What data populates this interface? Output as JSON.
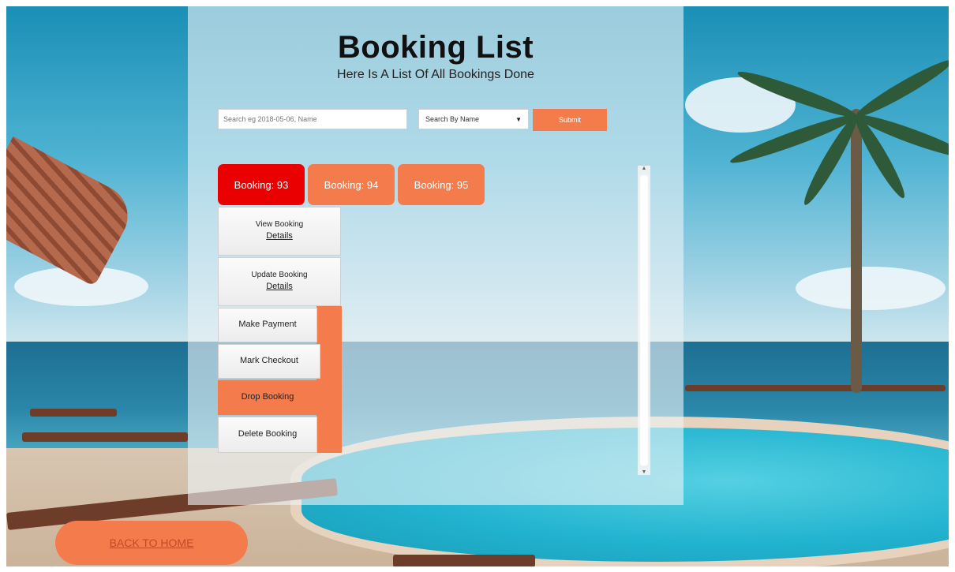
{
  "header": {
    "title": "Booking List",
    "subtitle": "Here Is A List Of All Bookings Done"
  },
  "search": {
    "placeholder": "Search eg 2018-05-06, Name",
    "filter_selected": "Search By Name",
    "submit_label": "Submit"
  },
  "tabs": [
    {
      "label": "Booking: 93",
      "active": true
    },
    {
      "label": "Booking: 94",
      "active": false
    },
    {
      "label": "Booking: 95",
      "active": false
    }
  ],
  "actions": {
    "view_line1": "View Booking",
    "view_line2": "Details",
    "update_line1": "Update Booking",
    "update_line2": "Details",
    "payment": "Make Payment",
    "checkout": "Mark Checkout",
    "drop": "Drop Booking",
    "delete": "Delete Booking"
  },
  "footer": {
    "back_label": "BACK TO HOME"
  },
  "colors": {
    "accent": "#f47c4c",
    "active_tab": "#ea0000"
  },
  "icons": {
    "select_caret": "caret-down-icon",
    "scroll_up": "scroll-up-arrow-icon",
    "scroll_down": "scroll-down-arrow-icon"
  }
}
